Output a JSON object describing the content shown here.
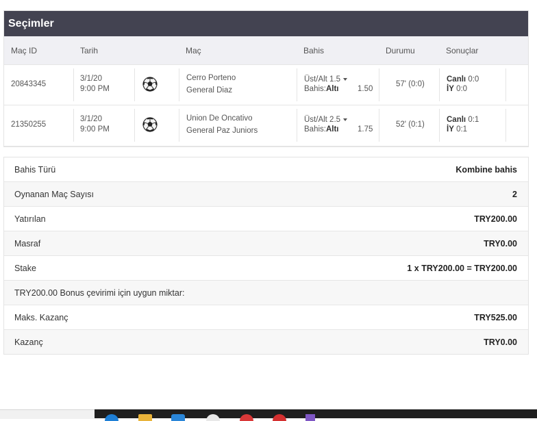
{
  "selections": {
    "title": "Seçimler",
    "columns": {
      "match_id": "Maç ID",
      "date": "Tarih",
      "match": "Maç",
      "bet": "Bahis",
      "status": "Durumu",
      "results": "Sonuçlar"
    },
    "rows": [
      {
        "match_id": "20843345",
        "date": "3/1/20",
        "time": "9:00 PM",
        "sport_icon": "soccer-ball-icon",
        "home": "Cerro Porteno",
        "away": "General Diaz",
        "market": "Üst/Alt 1.5",
        "bet_label": "Bahis:",
        "bet_pick": "Altı",
        "odds": "1.50",
        "status": "57' (0:0)",
        "live_label": "Canlı",
        "live_score": "0:0",
        "ht_label": "İY",
        "ht_score": "0:0"
      },
      {
        "match_id": "21350255",
        "date": "3/1/20",
        "time": "9:00 PM",
        "sport_icon": "soccer-ball-icon",
        "home": "Union De Oncativo",
        "away": "General Paz Juniors",
        "market": "Üst/Alt 2.5",
        "bet_label": "Bahis:",
        "bet_pick": "Altı",
        "odds": "1.75",
        "status": "52' (0:1)",
        "live_label": "Canlı",
        "live_score": "0:1",
        "ht_label": "İY",
        "ht_score": "0:1"
      }
    ]
  },
  "summary": [
    {
      "label": "Bahis Türü",
      "value": "Kombine bahis"
    },
    {
      "label": "Oynanan Maç Sayısı",
      "value": "2"
    },
    {
      "label": "Yatırılan",
      "value": "TRY200.00"
    },
    {
      "label": "Masraf",
      "value": "TRY0.00"
    },
    {
      "label": "Stake",
      "value": "1 x TRY200.00 = TRY200.00"
    },
    {
      "label": "TRY200.00 Bonus çevirimi için uygun miktar:",
      "value": ""
    },
    {
      "label": "Maks. Kazanç",
      "value": "TRY525.00"
    },
    {
      "label": "Kazanç",
      "value": "TRY0.00"
    }
  ],
  "colors": {
    "header_bg": "#434351",
    "column_header_bg": "#f0f0f4",
    "taskbar_bg": "#1f1f1f"
  },
  "taskbar": {
    "icons": [
      "edge-icon",
      "file-explorer-icon",
      "store-icon",
      "chrome-icon",
      "opera-icon",
      "app-icon",
      "visual-studio-icon"
    ]
  }
}
